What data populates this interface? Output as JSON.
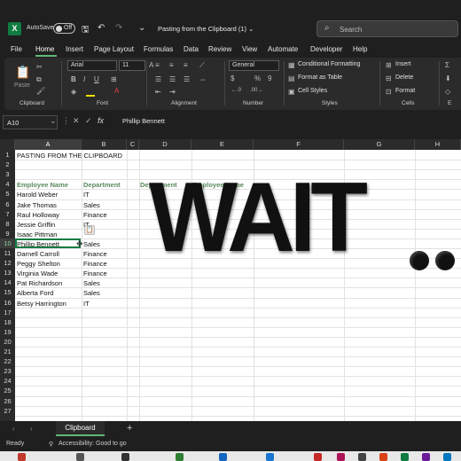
{
  "titlebar": {
    "app_logo": "X",
    "autosave_label": "AutoSave",
    "autosave_state": "Off",
    "doc_title": "Pasting from the Clipboard (1)",
    "doc_title_chevron": "⌄",
    "search_placeholder": "Search",
    "icons": [
      "save-icon",
      "undo-icon",
      "redo-icon",
      "customize-icon",
      "search-icon"
    ]
  },
  "tabs": [
    "File",
    "Home",
    "Insert",
    "Page Layout",
    "Formulas",
    "Data",
    "Review",
    "View",
    "Automate",
    "Developer",
    "Help"
  ],
  "ribbon": {
    "groups": [
      "Clipboard",
      "Font",
      "Alignment",
      "Number",
      "Styles",
      "Cells",
      "E"
    ],
    "paste_label": "Paste",
    "font_name": "Arial",
    "font_size": "11",
    "number_format": "General",
    "number_symbols": [
      "$",
      "%",
      "9"
    ],
    "styles_buttons": [
      "Conditional Formatting",
      "Format as Table",
      "Cell Styles"
    ],
    "cells_buttons": [
      "Insert",
      "Delete",
      "Format"
    ]
  },
  "formula_bar": {
    "name_box": "A10",
    "cancel": "✕",
    "enter": "✓",
    "fx": "fx",
    "content": "Phillip Bennett"
  },
  "columns": [
    "A",
    "B",
    "C",
    "D",
    "E",
    "F",
    "G",
    "H"
  ],
  "rows": [
    "1",
    "2",
    "3",
    "4",
    "5",
    "6",
    "7",
    "8",
    "9",
    "10",
    "11",
    "12",
    "13",
    "14",
    "15",
    "16",
    "17",
    "18",
    "19",
    "20",
    "21",
    "22",
    "23",
    "24",
    "25",
    "26",
    "27"
  ],
  "sheet": {
    "title": "PASTING FROM THE CLIPBOARD",
    "header_a": "Employee Name",
    "header_b": "Department",
    "header_d": "Department",
    "header_e": "Employee Name",
    "employees": [
      {
        "name": "Harold Weber",
        "dept": "IT"
      },
      {
        "name": "Jake Thomas",
        "dept": "Sales"
      },
      {
        "name": "Raul Holloway",
        "dept": "Finance"
      },
      {
        "name": "Jessie Griffin",
        "dept": "IT"
      },
      {
        "name": "Isaac Pittman",
        "dept": ""
      },
      {
        "name": "Phillip Bennett",
        "dept": "Sales"
      },
      {
        "name": "Darnell Carroll",
        "dept": "Finance"
      },
      {
        "name": "Peggy Shelton",
        "dept": "Finance"
      },
      {
        "name": "Virginia Wade",
        "dept": "Finance"
      },
      {
        "name": "Pat Richardson",
        "dept": "Sales"
      },
      {
        "name": "Alberta Ford",
        "dept": "Sales"
      },
      {
        "name": "Betsy Harrington",
        "dept": "IT"
      }
    ]
  },
  "overlay_text": "WAIT",
  "sheet_tabs": [
    "Clipboard"
  ],
  "add_sheet": "+",
  "status": {
    "ready": "Ready",
    "accessibility": "Accessibility: Good to go"
  },
  "colors": {
    "accent": "#107c41",
    "header_green": "#5a8a5f",
    "dark_bg": "#1f1f1f"
  }
}
